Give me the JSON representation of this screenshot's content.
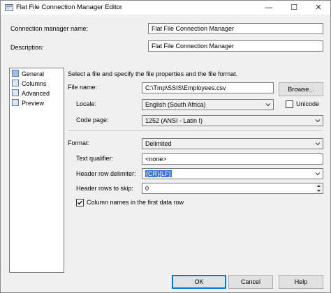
{
  "window": {
    "title": "Flat File Connection Manager Editor",
    "minimize_glyph": "—",
    "maximize_glyph": "☐",
    "close_glyph": "✕"
  },
  "header": {
    "connection_name_label": "Connection manager name:",
    "connection_name_value": "Flat File Connection Manager",
    "description_label": "Description:",
    "description_value": "Flat File Connection Manager"
  },
  "nav": {
    "items": [
      {
        "label": "General"
      },
      {
        "label": "Columns"
      },
      {
        "label": "Advanced"
      },
      {
        "label": "Preview"
      }
    ]
  },
  "general": {
    "instruction": "Select a file and specify the file properties and the file format.",
    "file_name_label": "File name:",
    "file_name_value": "C:\\Tmp\\SSIS\\Employees.csv",
    "browse_label": "Browse...",
    "locale_label": "Locale:",
    "locale_value": "English (South Africa)",
    "unicode_label": "Unicode",
    "unicode_checked": false,
    "code_page_label": "Code page:",
    "code_page_value": "1252  (ANSI - Latin I)",
    "format_label": "Format:",
    "format_value": "Delimited",
    "text_qualifier_label": "Text qualifier:",
    "text_qualifier_value": "<none>",
    "header_row_delimiter_label": "Header row delimiter:",
    "header_row_delimiter_value": "{CR}{LF}",
    "header_rows_skip_label": "Header rows to skip:",
    "header_rows_skip_value": "0",
    "column_names_label": "Column names in the first data row",
    "column_names_checked": true
  },
  "footer": {
    "ok_label": "OK",
    "cancel_label": "Cancel",
    "help_label": "Help"
  },
  "colors": {
    "accent": "#0078d7",
    "selection": "#3875d7"
  }
}
